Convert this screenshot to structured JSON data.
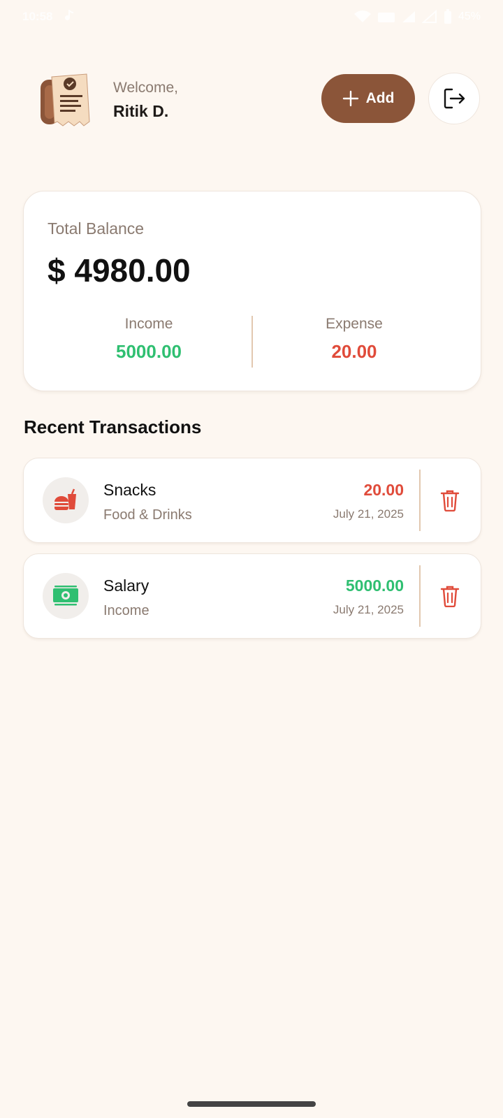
{
  "status_bar": {
    "time": "10:58",
    "battery": "45%"
  },
  "header": {
    "welcome": "Welcome,",
    "user_name": "Ritik D.",
    "add_label": "Add",
    "logo_icon": "receipt-logo-icon",
    "logout_icon": "logout-icon"
  },
  "balance": {
    "label": "Total Balance",
    "value": "$ 4980.00",
    "income_label": "Income",
    "income_value": "5000.00",
    "expense_label": "Expense",
    "expense_value": "20.00"
  },
  "section_title": "Recent Transactions",
  "transactions": [
    {
      "name": "Snacks",
      "category": "Food & Drinks",
      "amount": "20.00",
      "date": "July 21, 2025",
      "type": "expense",
      "icon": "burger-soda-icon"
    },
    {
      "name": "Salary",
      "category": "Income",
      "amount": "5000.00",
      "date": "July 21, 2025",
      "type": "income",
      "icon": "money-icon"
    }
  ],
  "colors": {
    "background": "#fdf7f1",
    "accent": "#8b5539",
    "income": "#2fbf71",
    "expense": "#e04b3a"
  }
}
